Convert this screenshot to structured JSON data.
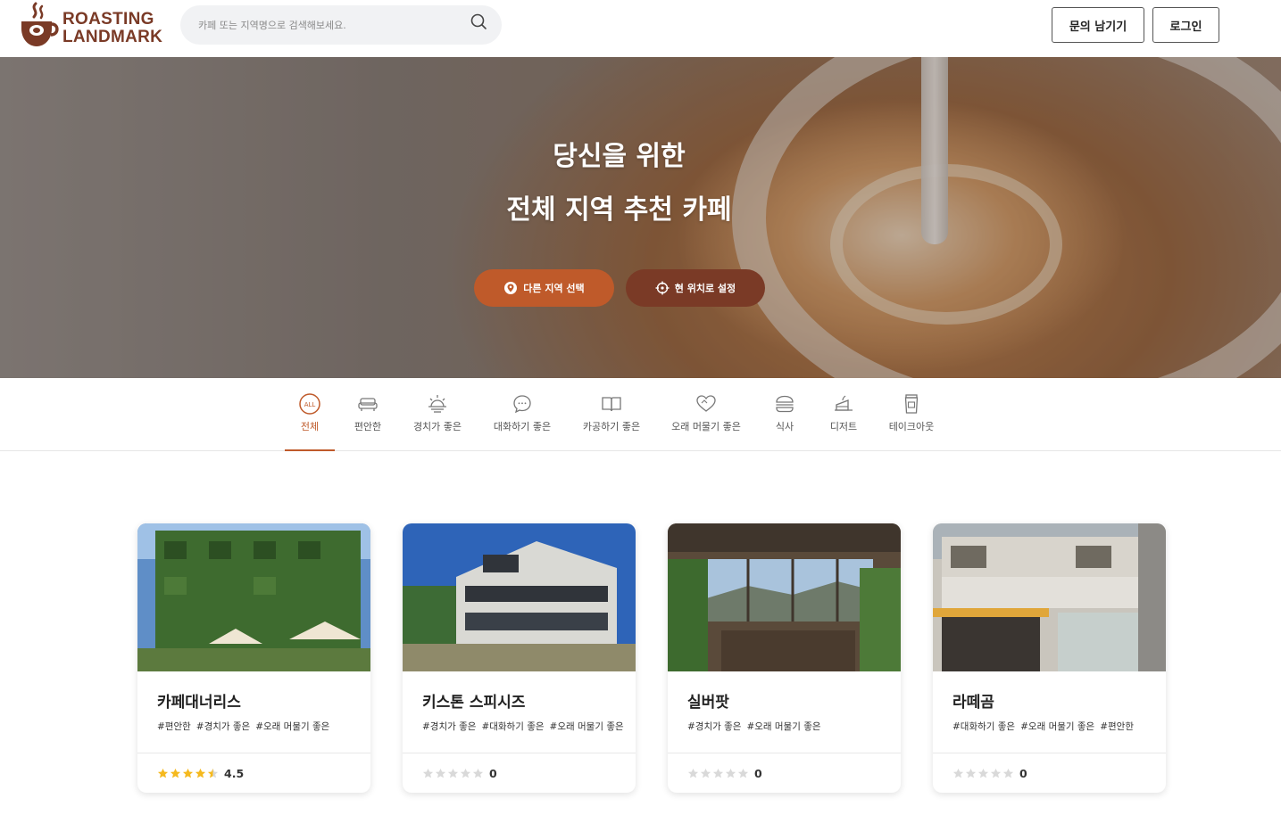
{
  "brand": {
    "line1": "ROASTING",
    "line2": "LANDMARK"
  },
  "search": {
    "placeholder": "카페 또는 지역명으로 검색해보세요."
  },
  "header": {
    "inquiry_label": "문의 남기기",
    "login_label": "로그인"
  },
  "hero": {
    "title_line1": "당신을 위한",
    "title_line2": "전체 지역 추천 카페",
    "region_button": "다른 지역 선택",
    "location_button": "현 위치로 설정"
  },
  "categories": [
    {
      "label": "전체",
      "icon": "all-icon",
      "active": true
    },
    {
      "label": "편안한",
      "icon": "sofa-icon"
    },
    {
      "label": "경치가 좋은",
      "icon": "sunrise-icon"
    },
    {
      "label": "대화하기 좋은",
      "icon": "chat-bubble-icon"
    },
    {
      "label": "카공하기 좋은",
      "icon": "book-icon"
    },
    {
      "label": "오래 머물기 좋은",
      "icon": "heart-icon"
    },
    {
      "label": "식사",
      "icon": "burger-icon"
    },
    {
      "label": "디저트",
      "icon": "cake-icon"
    },
    {
      "label": "테이크아웃",
      "icon": "takeout-cup-icon"
    }
  ],
  "cafes": [
    {
      "name": "카페대너리스",
      "tags": [
        "#편안한",
        "#경치가 좋은",
        "#오래 머물기 좋은"
      ],
      "rating": 4.5,
      "rating_label": "4.5"
    },
    {
      "name": "키스톤 스피시즈",
      "tags": [
        "#경치가 좋은",
        "#대화하기 좋은",
        "#오래 머물기 좋은"
      ],
      "rating": 0,
      "rating_label": "0"
    },
    {
      "name": "실버팟",
      "tags": [
        "#경치가 좋은",
        "#오래 머물기 좋은"
      ],
      "rating": 0,
      "rating_label": "0"
    },
    {
      "name": "라떼곰",
      "tags": [
        "#대화하기 좋은",
        "#오래 머물기 좋은",
        "#편안한"
      ],
      "rating": 0,
      "rating_label": "0"
    }
  ],
  "colors": {
    "accent": "#bf5a2a",
    "brand_brown": "#7a3a26",
    "star_gold": "#f5b91e",
    "star_empty": "#d9d9d9"
  }
}
